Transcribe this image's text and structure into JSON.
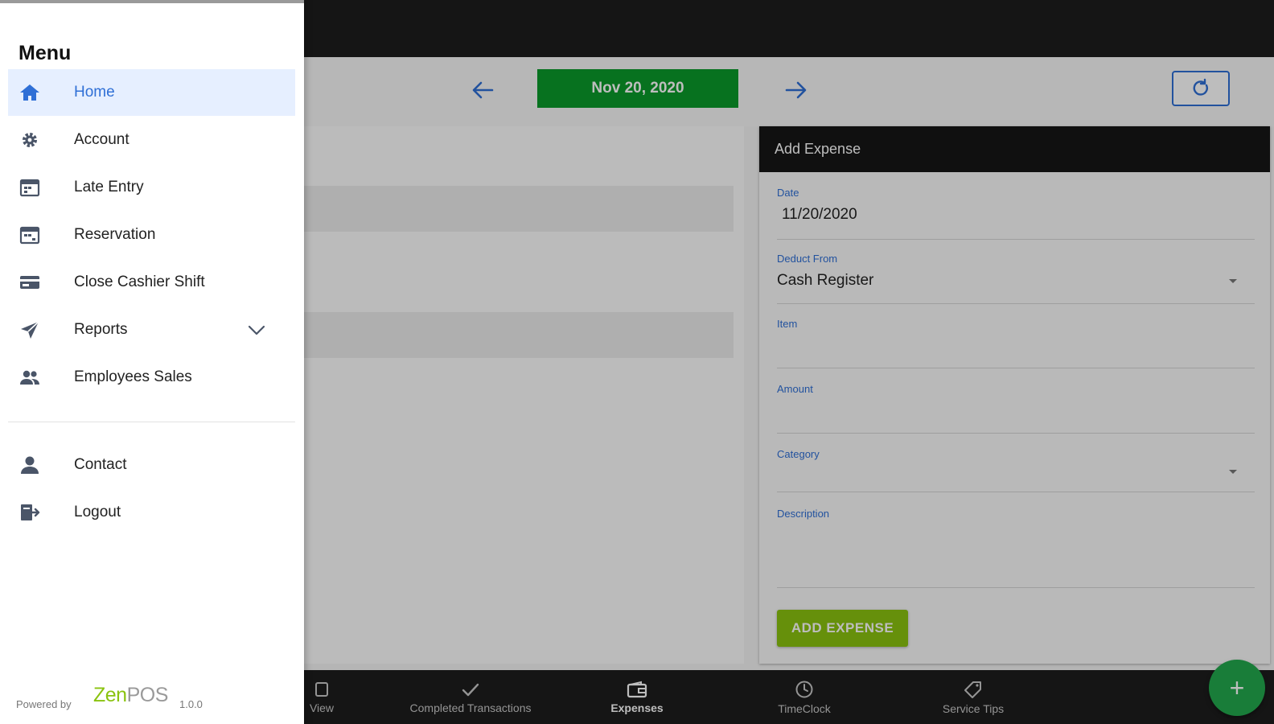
{
  "header": {
    "date_label": "Nov 20, 2020"
  },
  "expense_form": {
    "title": "Add Expense",
    "date_label": "Date",
    "date_value": "11/20/2020",
    "deduct_from_label": "Deduct From",
    "deduct_from_value": "Cash Register",
    "item_label": "Item",
    "amount_label": "Amount",
    "category_label": "Category",
    "description_label": "Description",
    "submit_label": "ADD EXPENSE"
  },
  "bottom_nav": {
    "items": [
      {
        "label": "View",
        "icon": "view-icon"
      },
      {
        "label": "Completed Transactions",
        "icon": "check-icon"
      },
      {
        "label": "Expenses",
        "icon": "wallet-icon",
        "active": true
      },
      {
        "label": "TimeClock",
        "icon": "clock-icon"
      },
      {
        "label": "Service Tips",
        "icon": "tag-icon"
      }
    ]
  },
  "fab": {
    "label": "+"
  },
  "drawer": {
    "title": "Menu",
    "items": [
      {
        "label": "Home",
        "icon": "home-icon",
        "active": true
      },
      {
        "label": "Account",
        "icon": "gear-icon"
      },
      {
        "label": "Late Entry",
        "icon": "calendar-icon"
      },
      {
        "label": "Reservation",
        "icon": "calendar-icon"
      },
      {
        "label": "Close Cashier Shift",
        "icon": "card-icon"
      },
      {
        "label": "Reports",
        "icon": "send-icon",
        "expandable": true
      },
      {
        "label": "Employees Sales",
        "icon": "people-icon"
      },
      {
        "label": "Contact",
        "icon": "person-icon"
      },
      {
        "label": "Logout",
        "icon": "logout-icon"
      }
    ],
    "footer": {
      "powered_by": "Powered by",
      "brand_zen": "Zen",
      "brand_pos": "POS",
      "version": "1.0.0"
    }
  },
  "colors": {
    "accent_blue": "#2f6fd6",
    "date_green": "#0a9a2b",
    "add_button_green": "#8ac30f",
    "fab_green": "#23a94d",
    "dark_bar": "#1d1d1d"
  }
}
